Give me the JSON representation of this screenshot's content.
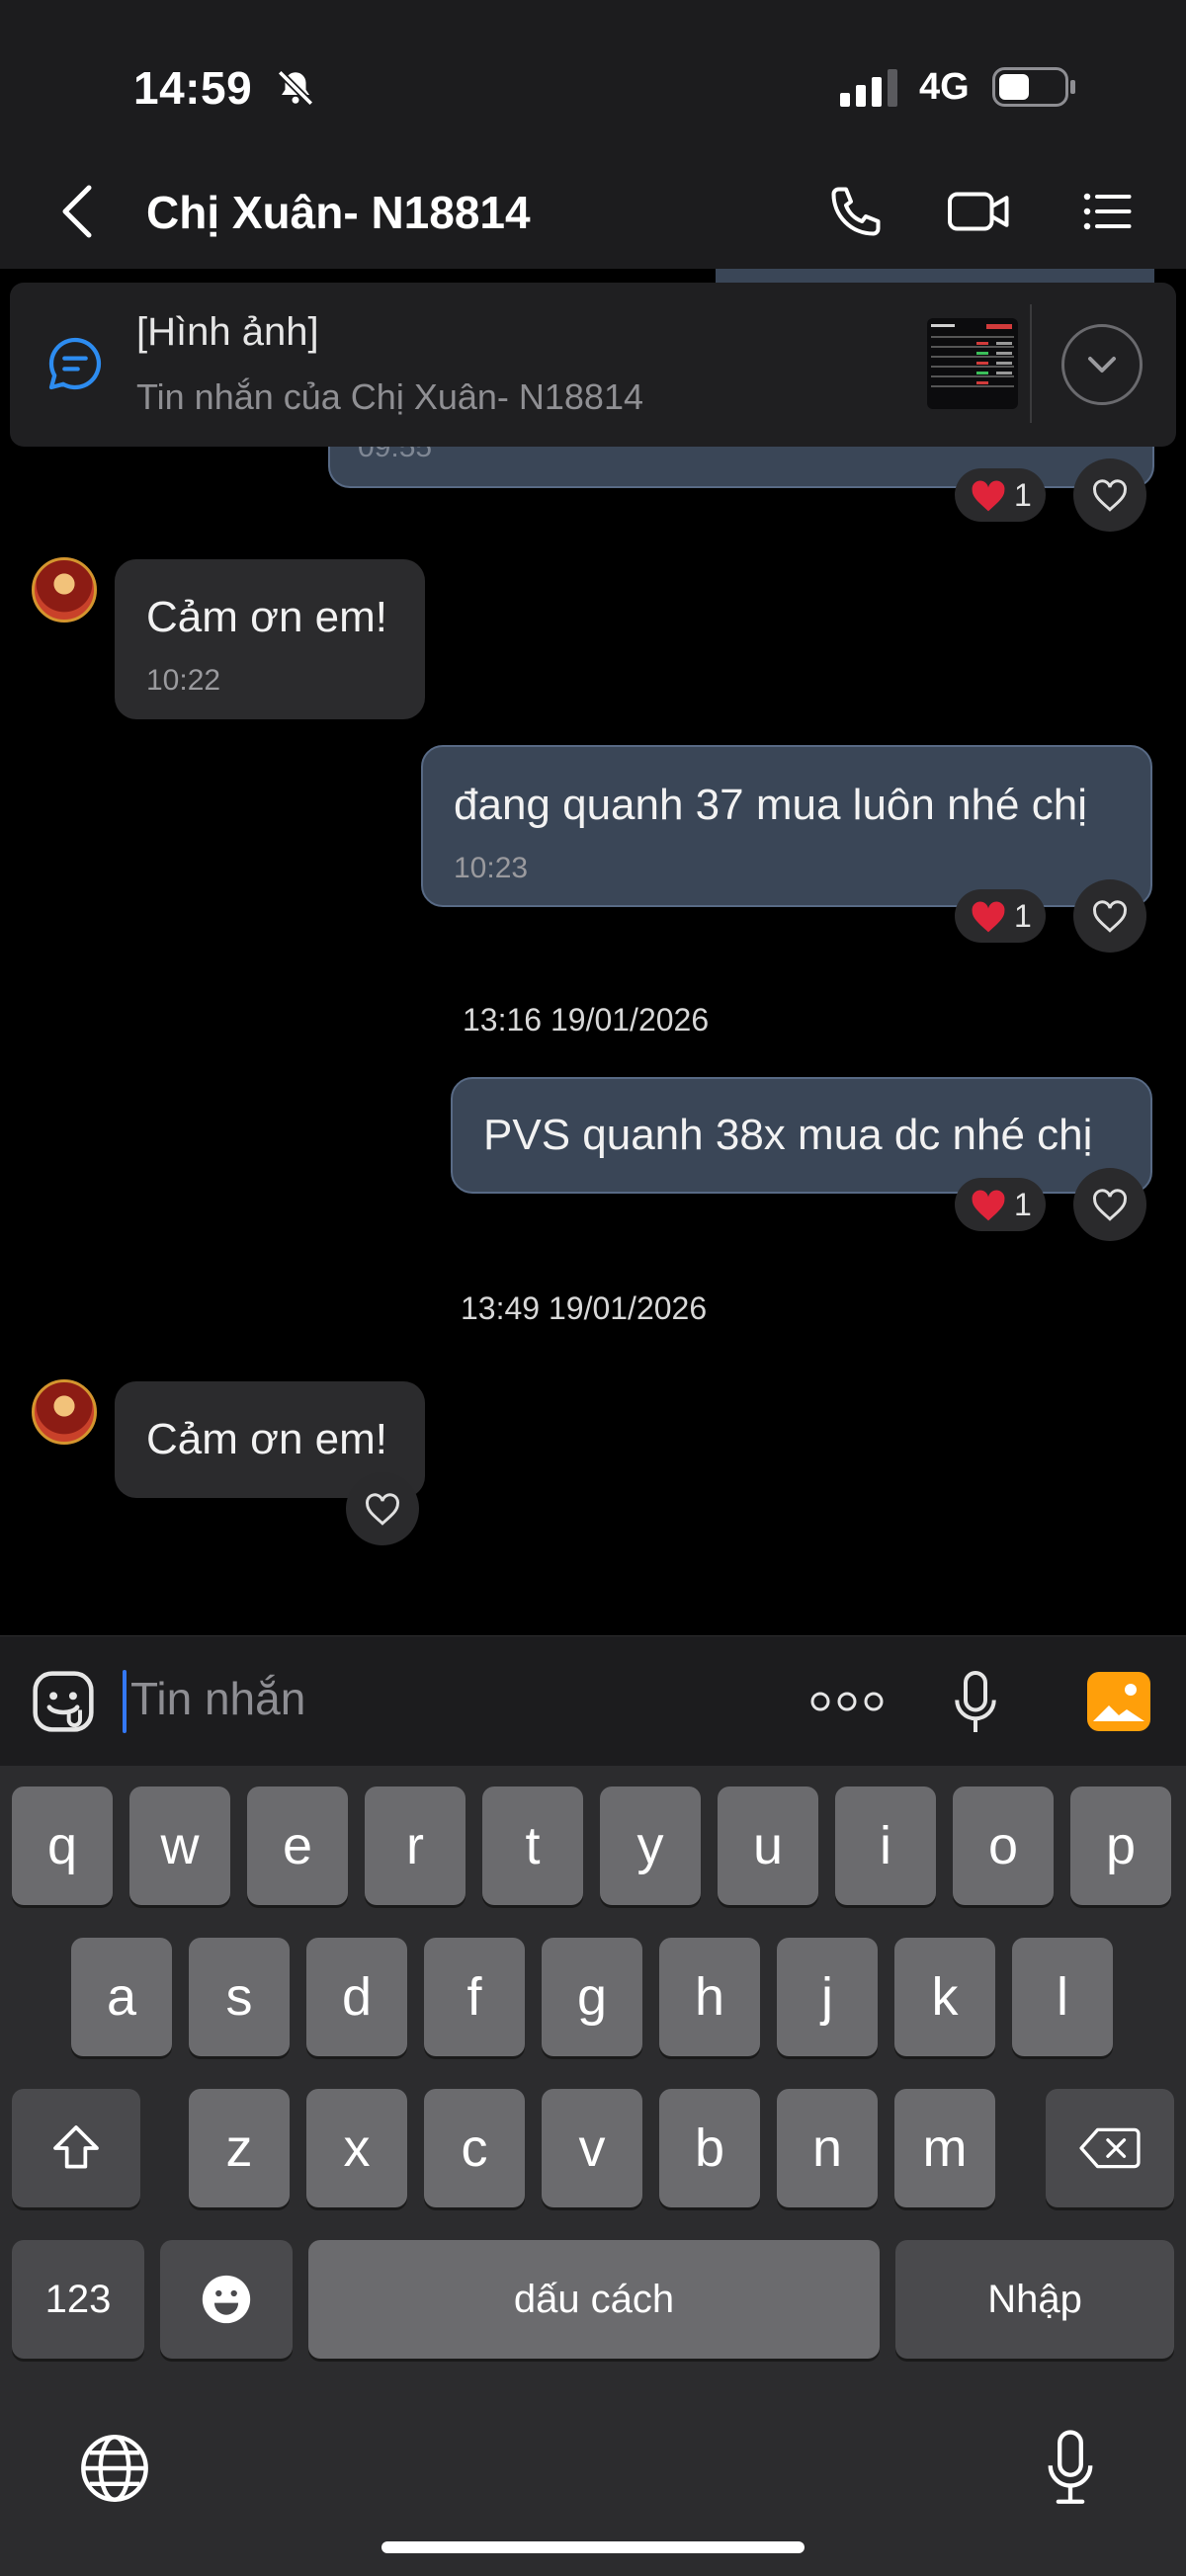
{
  "status_bar": {
    "time": "14:59",
    "network": "4G"
  },
  "header": {
    "title": "Chị Xuân- N18814"
  },
  "pinned": {
    "title": "[Hình ảnh]",
    "subtitle": "Tin nhắn của Chị Xuân- N18814",
    "partial_time": "09:55"
  },
  "messages": [
    {
      "text": "Cảm ơn em!",
      "time": "10:22"
    },
    {
      "text": "đang quanh 37 mua luôn nhé chị",
      "time": "10:23",
      "reaction_count": "1"
    },
    {
      "text": "PVS quanh 38x mua dc nhé chị",
      "reaction_count": "1"
    },
    {
      "text": "Cảm ơn em!"
    }
  ],
  "top_reaction_count": "1",
  "timestamps": [
    "13:16 19/01/2026",
    "13:49 19/01/2026"
  ],
  "composer": {
    "placeholder": "Tin nhắn"
  },
  "keyboard": {
    "row1": [
      "q",
      "w",
      "e",
      "r",
      "t",
      "y",
      "u",
      "i",
      "o",
      "p"
    ],
    "row2": [
      "a",
      "s",
      "d",
      "f",
      "g",
      "h",
      "j",
      "k",
      "l"
    ],
    "row3": [
      "z",
      "x",
      "c",
      "v",
      "b",
      "n",
      "m"
    ],
    "numbers": "123",
    "space": "dấu cách",
    "return": "Nhập"
  },
  "colors": {
    "incoming": "#2b2b2d",
    "outgoing": "#3a4657",
    "accent": "#3478f6",
    "gallery": "#ff9f0a"
  }
}
